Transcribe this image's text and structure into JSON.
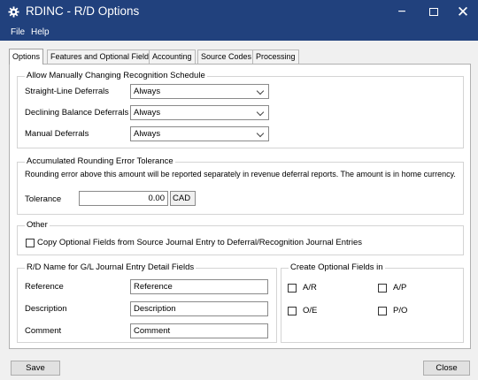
{
  "window": {
    "title": "RDINC - R/D Options",
    "min": "−",
    "close": "✕"
  },
  "menu": [
    "File",
    "Help"
  ],
  "tabs": [
    "Options",
    "Features and Optional Fields",
    "Accounting",
    "Source Codes",
    "Processing"
  ],
  "allow": {
    "legend": "Allow Manually Changing Recognition Schedule",
    "rows": [
      {
        "label": "Straight-Line Deferrals",
        "value": "Always"
      },
      {
        "label": "Declining Balance Deferrals",
        "value": "Always"
      },
      {
        "label": "Manual Deferrals",
        "value": "Always"
      }
    ]
  },
  "rounding": {
    "legend": "Accumulated Rounding Error Tolerance",
    "description": "Rounding error above this amount will be reported separately in revenue deferral reports. The amount is in home currency.",
    "tolerance_label": "Tolerance",
    "tolerance_value": "0.00",
    "currency": "CAD"
  },
  "other": {
    "legend": "Other",
    "copy_label": "Copy Optional Fields from Source Journal Entry to Deferral/Recognition Journal Entries"
  },
  "rdname": {
    "legend": "R/D Name for G/L Journal Entry Detail Fields",
    "rows": [
      {
        "label": "Reference",
        "value": "Reference"
      },
      {
        "label": "Description",
        "value": "Description"
      },
      {
        "label": "Comment",
        "value": "Comment"
      }
    ]
  },
  "optional": {
    "legend": "Create Optional Fields in",
    "items": [
      "A/R",
      "A/P",
      "O/E",
      "P/O"
    ]
  },
  "buttons": {
    "save": "Save",
    "close": "Close"
  },
  "colors": {
    "titlebar": "#21417d",
    "panel": "#ffffff",
    "background": "#f0f0f0"
  }
}
